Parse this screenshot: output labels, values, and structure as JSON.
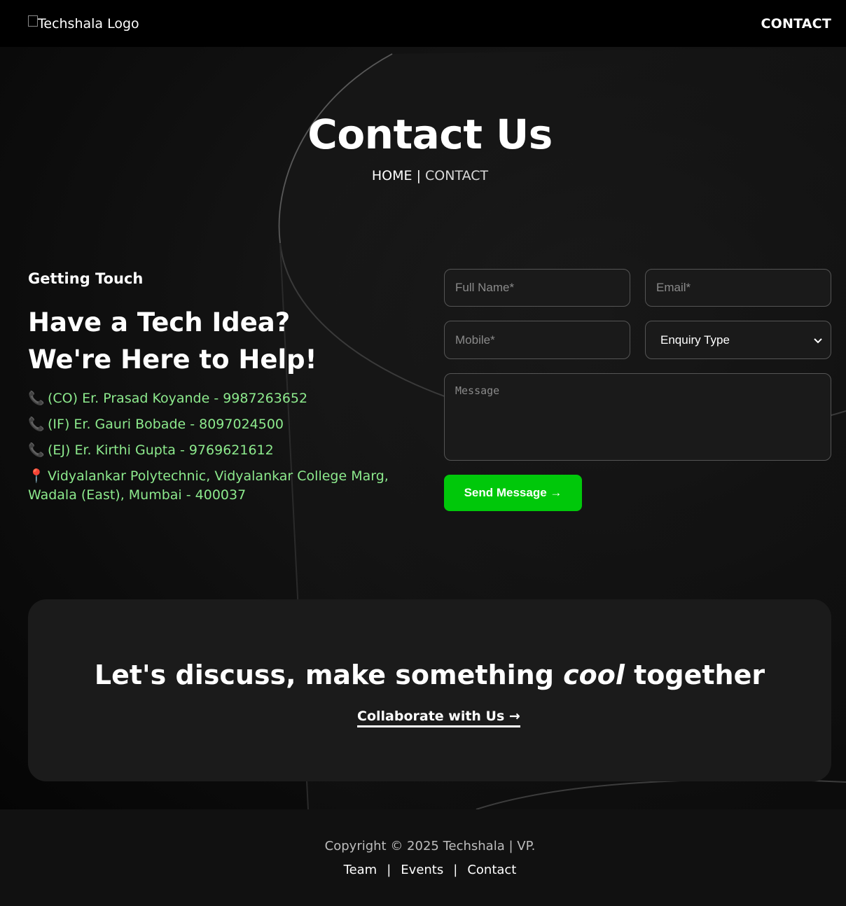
{
  "header": {
    "logo_alt": "Techshala Logo",
    "nav_contact": "CONTACT"
  },
  "hero": {
    "title": "Contact Us",
    "breadcrumb_home": "HOME",
    "breadcrumb_sep": "|",
    "breadcrumb_current": "CONTACT"
  },
  "info": {
    "eyebrow": "Getting Touch",
    "headline_line1": "Have a Tech Idea?",
    "headline_line2": "We're Here to Help!",
    "phone_icon": "phone-icon",
    "pin_icon": "pin-icon",
    "contacts": [
      "(CO) Er. Prasad Koyande - 9987263652",
      "(IF) Er. Gauri Bobade - 8097024500",
      "(EJ) Er. Kirthi Gupta - 9769621612"
    ],
    "address": "Vidyalankar Polytechnic, Vidyalankar College Marg, Wadala (East), Mumbai - 400037"
  },
  "form": {
    "name_placeholder": "Full Name*",
    "email_placeholder": "Email*",
    "mobile_placeholder": "Mobile*",
    "enquiry_selected": "Enquiry Type",
    "message_placeholder": "Message",
    "send_label": "Send Message →"
  },
  "cta": {
    "title_before": "Let's discuss, make something ",
    "title_em": "cool",
    "title_after": " together",
    "link_label": "Collaborate with Us →"
  },
  "footer": {
    "copyright": "Copyright © 2025 Techshala | VP.",
    "links": [
      "Team",
      "Events",
      "Contact"
    ],
    "divider": "|"
  },
  "colors": {
    "accent_green": "#00c80a",
    "info_text_green": "#8dea8d",
    "phone_icon_pink": "#e23b8e"
  }
}
